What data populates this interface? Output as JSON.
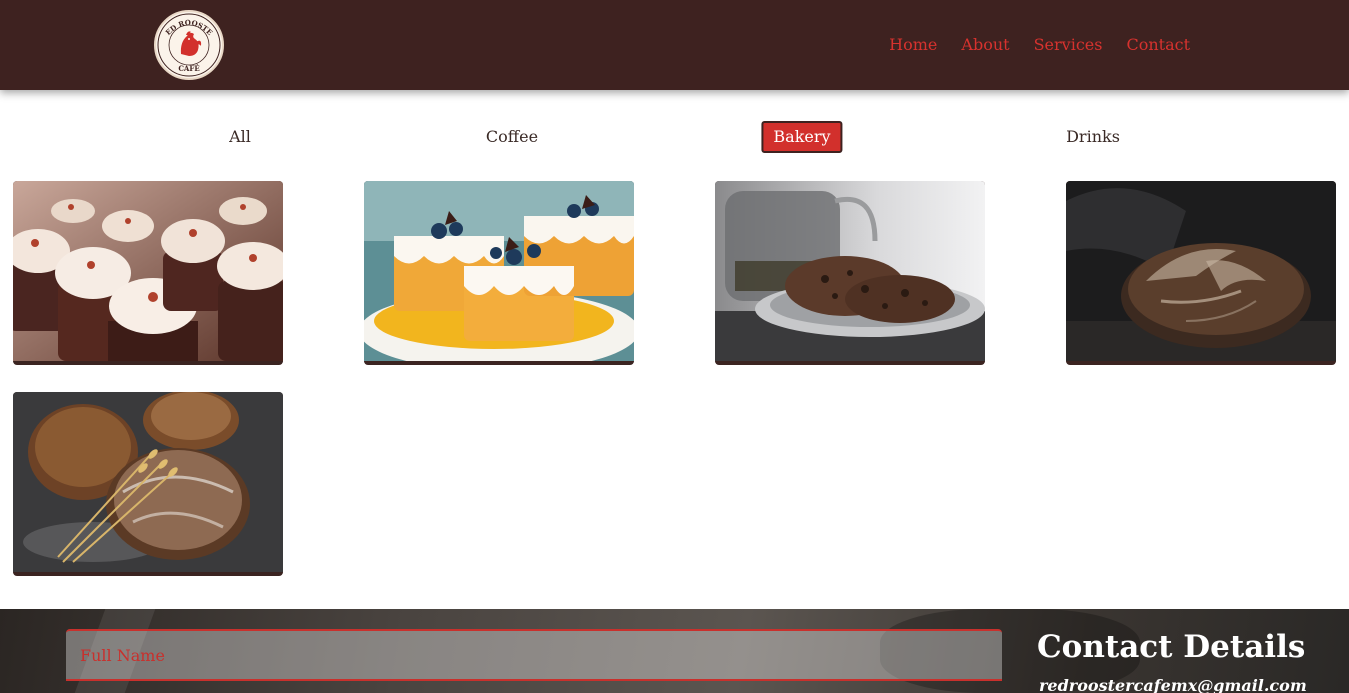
{
  "header": {
    "logo_alt": "Red Rooster Cafe",
    "logo_text_top": "RED ROOSTER",
    "logo_text_bottom": "CAFÉ",
    "nav": [
      "Home",
      "About",
      "Services",
      "Contact"
    ]
  },
  "filters": {
    "items": [
      "All",
      "Coffee",
      "Bakery",
      "Drinks"
    ],
    "active": "Bakery"
  },
  "gallery": {
    "items": [
      {
        "image": "cupcakes-photo"
      },
      {
        "image": "blueberry-cakes-photo"
      },
      {
        "image": "cookies-and-teapot-photo"
      },
      {
        "image": "sourdough-bread-photo"
      },
      {
        "image": "rye-bread-with-wheat-photo"
      }
    ]
  },
  "contact_form": {
    "full_name_placeholder": "Full Name"
  },
  "contact_details": {
    "title": "Contact Details",
    "email": "redroostercafemx@gmail.com"
  },
  "colors": {
    "header_bg": "#3e2220",
    "accent": "#d2302c"
  }
}
